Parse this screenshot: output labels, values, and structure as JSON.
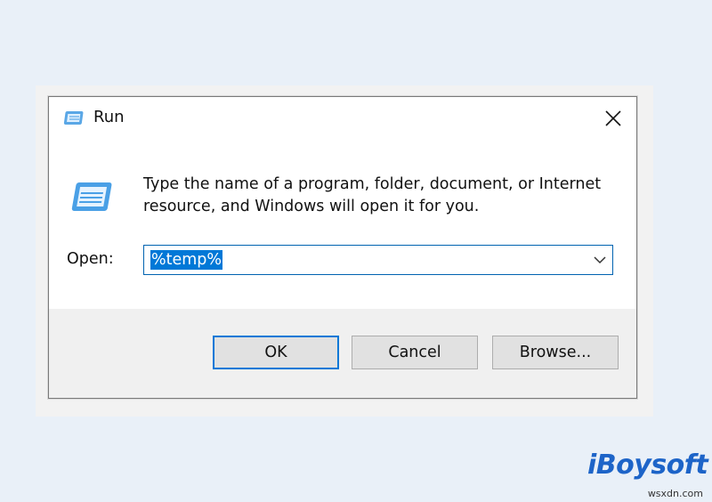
{
  "dialog": {
    "title": "Run",
    "description": "Type the name of a program, folder, document, or Internet resource, and Windows will open it for you.",
    "open_label": "Open:",
    "open_value": "%temp%",
    "buttons": {
      "ok": "OK",
      "cancel": "Cancel",
      "browse": "Browse..."
    },
    "accent_color": "#0078d7"
  },
  "brand": {
    "name": "iBoysoft"
  },
  "watermark": "wsxdn.com"
}
